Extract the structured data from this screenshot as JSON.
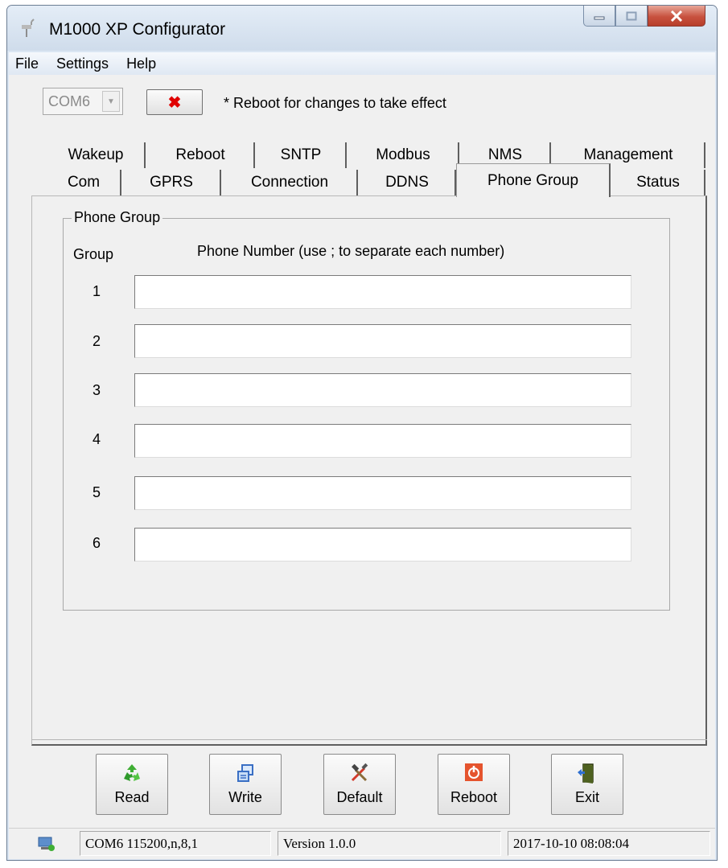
{
  "window": {
    "title": "M1000 XP Configurator",
    "icon": "app-antenna-icon",
    "controls": [
      "minimize-icon",
      "maximize-icon",
      "close-icon"
    ]
  },
  "menu": [
    "File",
    "Settings",
    "Help"
  ],
  "toolbar": {
    "com_port": "COM6",
    "disconnect_symbol": "✖",
    "reboot_note": "* Reboot for changes to take effect"
  },
  "tabs": {
    "row1": [
      "Wakeup",
      "Reboot",
      "SNTP",
      "Modbus",
      "NMS",
      "Management"
    ],
    "row2": [
      "Com",
      "GPRS",
      "Connection",
      "DDNS",
      "Phone Group",
      "Status"
    ],
    "active": "Phone Group"
  },
  "phone_group": {
    "legend": "Phone Group",
    "col_group": "Group",
    "col_phone": "Phone Number (use ; to separate each number)",
    "rows": [
      {
        "num": "1",
        "value": ""
      },
      {
        "num": "2",
        "value": ""
      },
      {
        "num": "3",
        "value": ""
      },
      {
        "num": "4",
        "value": ""
      },
      {
        "num": "5",
        "value": ""
      },
      {
        "num": "6",
        "value": ""
      }
    ]
  },
  "buttons": [
    {
      "label": "Read",
      "icon": "recycle-icon"
    },
    {
      "label": "Write",
      "icon": "copy-pages-icon"
    },
    {
      "label": "Default",
      "icon": "tools-icon"
    },
    {
      "label": "Reboot",
      "icon": "power-icon"
    },
    {
      "label": "Exit",
      "icon": "exit-door-icon"
    }
  ],
  "status": {
    "connection": "COM6 115200,n,8,1",
    "version": "Version 1.0.0",
    "datetime": "2017-10-10 08:08:04",
    "icon": "network-status-icon"
  },
  "colors": {
    "close_button": "#c8523f",
    "disconnect_x": "#e00000",
    "panel": "#f0f0f0",
    "frame": "#dbe6f3"
  }
}
